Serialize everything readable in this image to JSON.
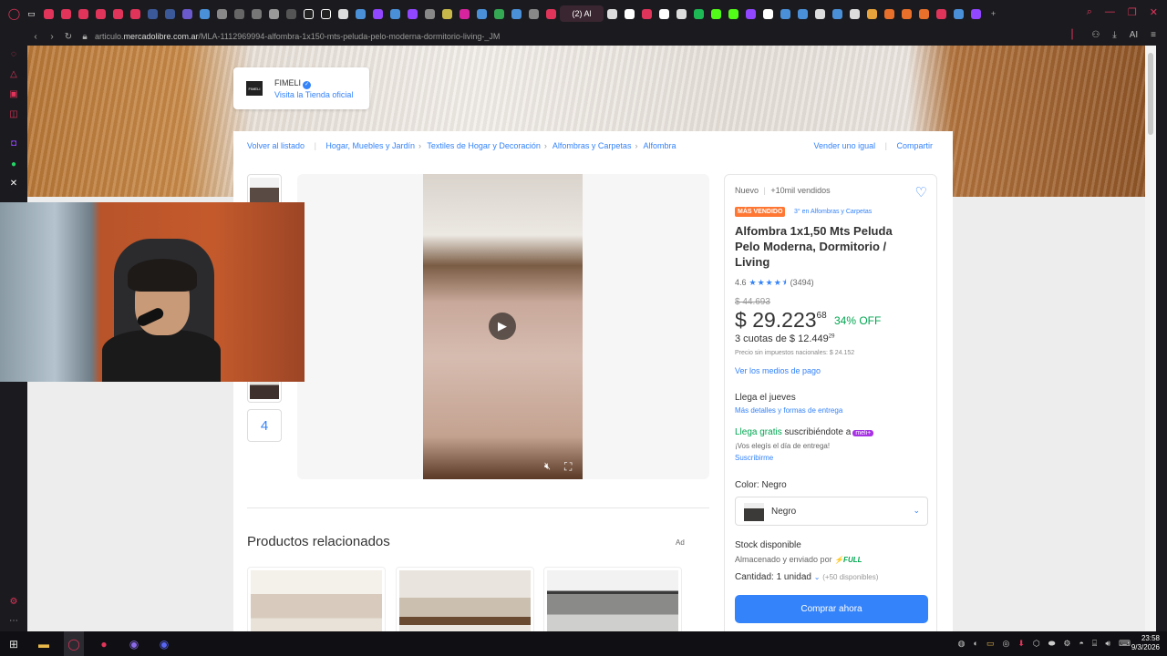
{
  "browser": {
    "active_tab_label": "(2) Al",
    "url_prefix": "articulo.",
    "url_domain": "mercadolibre.com.ar",
    "url_path": "/MLA-1112969994-alfombra-1x150-mts-peluda-pelo-moderna-dormitorio-living-_JM",
    "ai_label": "AI"
  },
  "store": {
    "name": "FIMELI",
    "logo_text": "FIMELI",
    "link": "Visita la Tienda oficial"
  },
  "breadcrumbs": {
    "back": "Volver al listado",
    "items": [
      "Hogar, Muebles y Jardín",
      "Textiles de Hogar y Decoración",
      "Alfombras y Carpetas",
      "Alfombra"
    ],
    "sell": "Vender uno igual",
    "share": "Compartir"
  },
  "gallery": {
    "more_count": "4"
  },
  "product": {
    "condition": "Nuevo",
    "sold": "+10mil vendidos",
    "badge": "MÁS VENDIDO",
    "rank": "3° en Alfombras y Carpetas",
    "title": "Alfombra 1x1,50 Mts Peluda Pelo Moderna, Dormitorio / Living",
    "rating_value": "4.6",
    "stars": "★★★★⯨",
    "rating_count": "(3494)",
    "old_price": "$ 44.693",
    "price_currency": "$",
    "price_int": "29.223",
    "price_cents": "68",
    "discount": "34% OFF",
    "installments": "3 cuotas de $ 12.449",
    "installments_cents": "29",
    "tax_note": "Precio sin impuestos nacionales: $ 24.152",
    "payment_link": "Ver los medios de pago",
    "arrival": "Llega el jueves",
    "delivery_link": "Más detalles y formas de entrega",
    "free_label": "Llega gratis",
    "free_rest": "suscribiéndote a",
    "meli_plus": "meli+",
    "choose_day": "¡Vos elegís el día de entrega!",
    "subscribe": "Suscribirme",
    "color_label": "Color:",
    "color_value": "Negro",
    "color_select": "Negro",
    "stock": "Stock disponible",
    "stored_by": "Almacenado y enviado por",
    "full": "⚡FULL",
    "qty_label": "Cantidad:",
    "qty_value": "1 unidad",
    "qty_available": "(+50 disponibles)",
    "buy_now": "Comprar ahora"
  },
  "related": {
    "title": "Productos relacionados",
    "ad": "Ad"
  },
  "clock": {
    "time": "23:58",
    "date": "9/3/2026"
  },
  "colors": {
    "accent": "#3483fa",
    "green": "#00a650",
    "badge": "#ff7733",
    "opera": "#e0345a"
  }
}
